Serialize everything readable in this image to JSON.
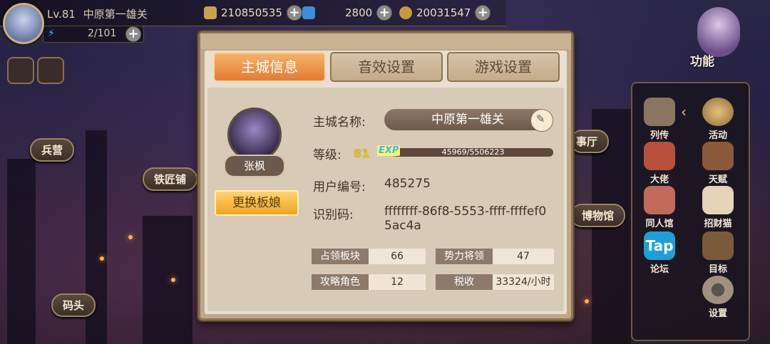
{
  "topbar": {
    "level_label": "Lv.81",
    "city_name": "中原第一雄关",
    "gold": "210850535",
    "gems": "2800",
    "food": "20031547",
    "stamina": "2/101"
  },
  "buildings": {
    "barracks": "兵营",
    "smithy": "铁匠铺",
    "museum": "博物馆",
    "dock": "码头",
    "hall": "事厅"
  },
  "right_menu": {
    "function": "功能",
    "items": [
      "列传",
      "活动",
      "大佬",
      "天赋",
      "同人馆",
      "招财猫",
      "论坛",
      "目标",
      "设置"
    ],
    "tap_logo": "Tap"
  },
  "dialog": {
    "tabs": [
      "主城信息",
      "音效设置",
      "游戏设置"
    ],
    "active_tab": 0,
    "portrait_name": "张枫",
    "swap_button": "更换板娘",
    "city_name_label": "主城名称:",
    "city_name_value": "中原第一雄关",
    "level_label": "等级:",
    "level_value": "81",
    "exp_tag": "EXP",
    "exp_text": "45969/5506223",
    "exp_progress": 0.0083,
    "user_id_label": "用户编号:",
    "user_id_value": "485275",
    "ident_label": "识别码:",
    "ident_value": "ffffffff-86f8-5553-ffff-ffffef05ac4a",
    "stats": [
      {
        "k": "占领板块",
        "v": "66"
      },
      {
        "k": "势力将领",
        "v": "47"
      },
      {
        "k": "攻略角色",
        "v": "12"
      },
      {
        "k": "税收",
        "v": "33324/小时"
      }
    ]
  },
  "colors": {
    "tab_active": "#e37b33",
    "button_gold": "#eea51f",
    "level_yellow": "#e0c21c"
  }
}
